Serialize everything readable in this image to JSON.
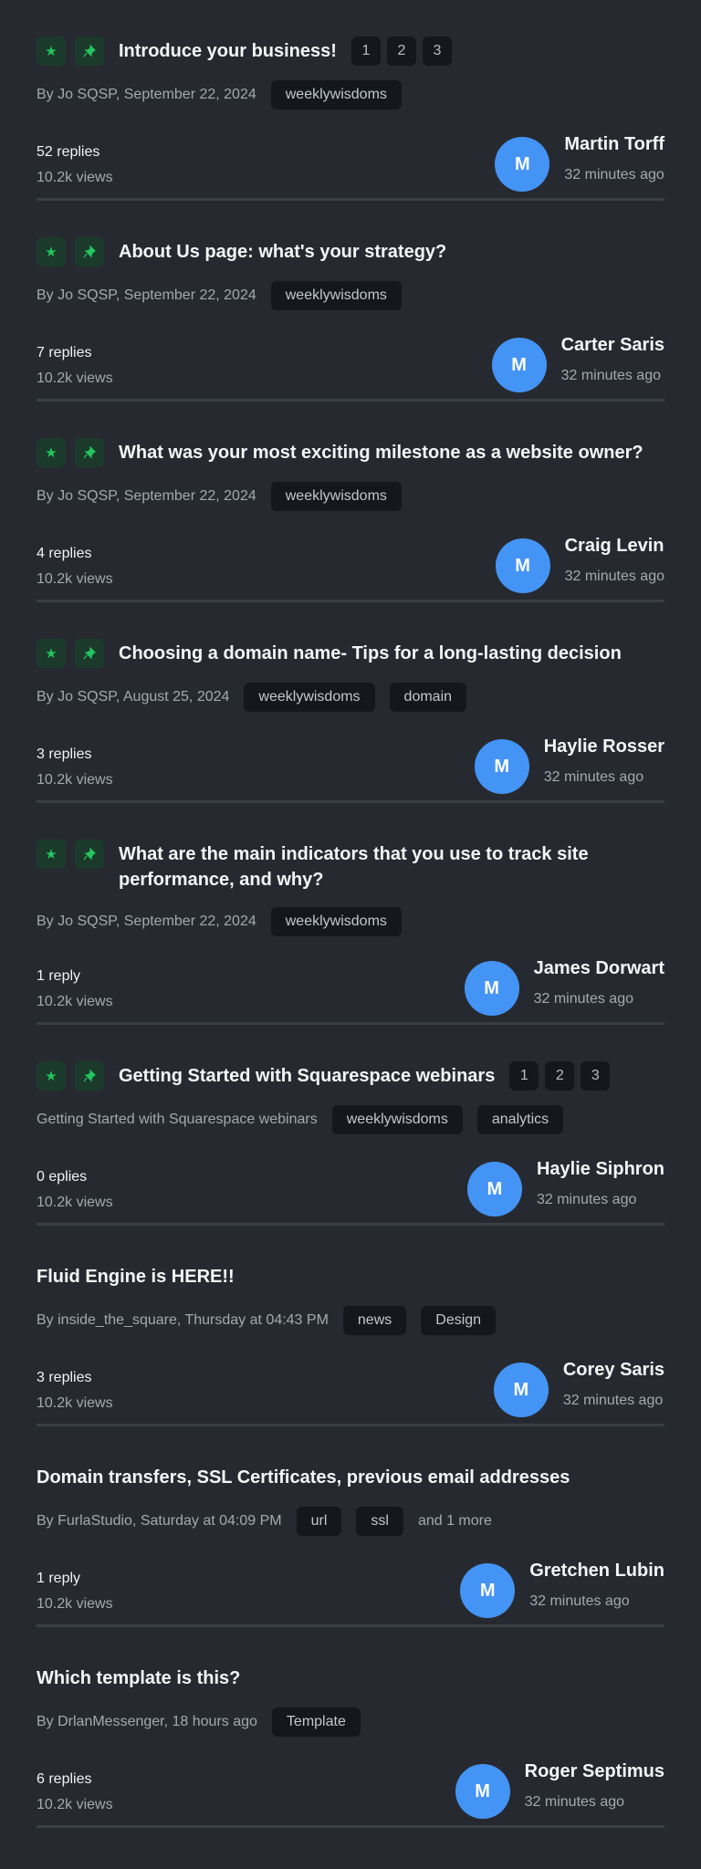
{
  "colors": {
    "background": "#262a30",
    "accent_green": "#22c55e",
    "avatar_blue": "#4494f5"
  },
  "topics": [
    {
      "title": "Introduce your business!",
      "icons": [
        "star-icon",
        "pin-icon"
      ],
      "pages": [
        "1",
        "2",
        "3"
      ],
      "byline": "By Jo SQSP, September 22, 2024",
      "tags": [
        "weeklywisdoms"
      ],
      "replies": "52 replies",
      "views": "10.2k views",
      "avatar": "M",
      "user": "Martin Torff",
      "time": "32 minutes ago"
    },
    {
      "title": "About Us page: what's your strategy?",
      "icons": [
        "star-icon",
        "pin-icon"
      ],
      "pages": [],
      "byline": "By Jo SQSP, September 22, 2024",
      "tags": [
        "weeklywisdoms"
      ],
      "replies": "7 replies",
      "views": "10.2k views",
      "avatar": "M",
      "user": "Carter Saris",
      "time": "32 minutes ago"
    },
    {
      "title": "What was your most exciting milestone as a website owner?",
      "icons": [
        "star-icon",
        "pin-icon"
      ],
      "pages": [],
      "byline": "By Jo SQSP, September 22, 2024",
      "tags": [
        "weeklywisdoms"
      ],
      "replies": "4 replies",
      "views": "10.2k views",
      "avatar": "M",
      "user": "Craig Levin",
      "time": "32 minutes ago"
    },
    {
      "title": "Choosing a domain name- Tips for a long-lasting decision",
      "icons": [
        "star-icon",
        "pin-icon"
      ],
      "pages": [],
      "byline": "By Jo SQSP, August 25, 2024",
      "tags": [
        "weeklywisdoms",
        "domain"
      ],
      "replies": "3 replies",
      "views": "10.2k views",
      "avatar": "M",
      "user": "Haylie Rosser",
      "time": "32 minutes ago"
    },
    {
      "title": "What are the main indicators that you use to track site performance, and why?",
      "icons": [
        "star-icon",
        "pin-icon"
      ],
      "pages": [],
      "byline": "By Jo SQSP, September 22, 2024",
      "tags": [
        "weeklywisdoms"
      ],
      "replies": "1 reply",
      "views": "10.2k views",
      "avatar": "M",
      "user": "James Dorwart",
      "time": "32 minutes ago",
      "two": true
    },
    {
      "title": "Getting Started with Squarespace webinars",
      "icons": [
        "star-icon",
        "pin-icon"
      ],
      "pages": [
        "1",
        "2",
        "3"
      ],
      "byline": "Getting Started with Squarespace webinars",
      "tags": [
        "weeklywisdoms",
        "analytics"
      ],
      "replies": "0 eplies",
      "views": "10.2k views",
      "avatar": "M",
      "user": "Haylie Siphron",
      "time": "32 minutes ago"
    },
    {
      "title": "Fluid Engine is HERE!!",
      "icons": [],
      "pages": [],
      "byline": "By inside_the_square, Thursday at 04:43 PM",
      "tags": [
        "news",
        "Design"
      ],
      "replies": "3 replies",
      "views": "10.2k views",
      "avatar": "M",
      "user": "Corey Saris",
      "time": "32 minutes ago"
    },
    {
      "title": "Domain transfers, SSL Certificates, previous email addresses",
      "icons": [],
      "pages": [],
      "byline": "By FurlaStudio, Saturday at 04:09 PM",
      "tags": [
        "url",
        "ssl"
      ],
      "more": "and 1 more",
      "replies": "1 reply",
      "views": "10.2k views",
      "avatar": "M",
      "user": "Gretchen Lubin",
      "time": "32 minutes ago"
    },
    {
      "title": "Which template is this?",
      "icons": [],
      "pages": [],
      "byline": "By DrlanMessenger, 18 hours ago",
      "tags": [
        "Template"
      ],
      "replies": "6 replies",
      "views": "10.2k views",
      "avatar": "M",
      "user": "Roger Septimus",
      "time": "32 minutes ago"
    }
  ]
}
